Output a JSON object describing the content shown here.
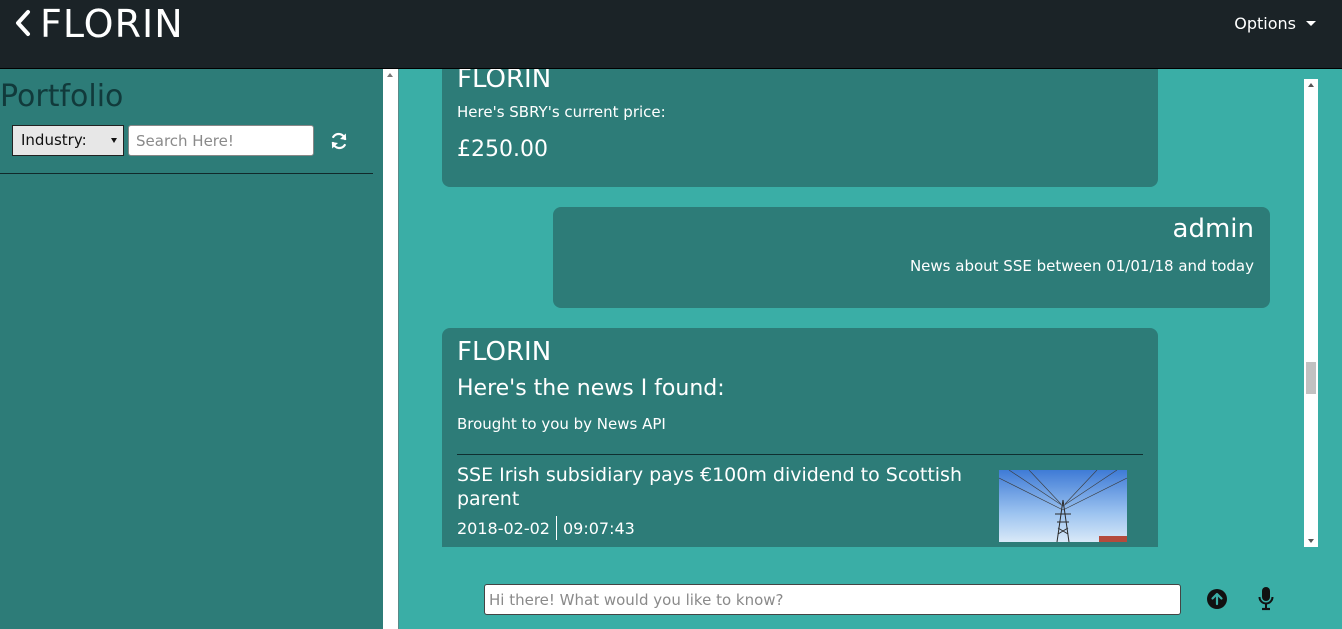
{
  "header": {
    "title": "FLORIN",
    "options_label": "Options"
  },
  "sidebar": {
    "title": "Portfolio",
    "industry_select": "Industry:",
    "search_placeholder": "Search Here!"
  },
  "messages": [
    {
      "sender": "FLORIN",
      "text": "Here's SBRY's current price:",
      "price": "£250.00"
    },
    {
      "sender": "admin",
      "text": "News about SSE between 01/01/18 and today"
    },
    {
      "sender": "FLORIN",
      "headline": "Here's the news I found:",
      "credit": "Brought to you by News API",
      "article": {
        "title": "SSE Irish subsidiary pays €100m dividend to Scottish parent",
        "date": "2018-02-02",
        "time": "09:07:43"
      }
    }
  ],
  "chat_input": {
    "placeholder": "Hi there! What would you like to know?"
  },
  "colors": {
    "topbar": "#1b2327",
    "sidebar": "#2d7c78",
    "background": "#3aaea6",
    "bubble": "#2d7c78"
  },
  "icons": {
    "back": "chevron-left-icon",
    "options": "caret-down-icon",
    "refresh": "refresh-icon",
    "send": "arrow-up-circle-icon",
    "mic": "microphone-icon"
  }
}
